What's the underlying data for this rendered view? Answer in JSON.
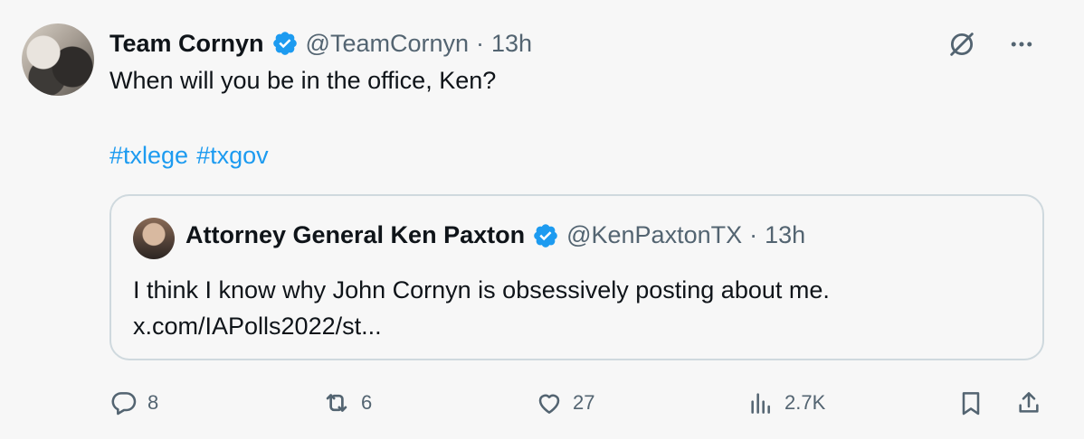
{
  "tweet": {
    "author_name": "Team Cornyn",
    "handle": "@TeamCornyn",
    "separator": "·",
    "time": "13h",
    "text": "When will you be in the office, Ken?",
    "hashtags": [
      "#txlege",
      "#txgov"
    ]
  },
  "quote": {
    "author_name": "Attorney General Ken Paxton",
    "handle": "@KenPaxtonTX",
    "separator": "·",
    "time": "13h",
    "text_line1": "I think I know why John Cornyn is obsessively posting about me.",
    "text_line2": "x.com/IAPolls2022/st..."
  },
  "actions": {
    "replies": "8",
    "reposts": "6",
    "likes": "27",
    "views": "2.7K"
  },
  "colors": {
    "link": "#1d9bf0",
    "verified": "#1d9bf0",
    "secondary_text": "#536471",
    "border": "#cfd9de"
  },
  "icons": {
    "verified": "verified-badge-icon",
    "grok": "grok-icon",
    "more": "more-icon",
    "reply": "reply-icon",
    "repost": "repost-icon",
    "like": "like-icon",
    "views": "views-icon",
    "bookmark": "bookmark-icon",
    "share": "share-icon"
  }
}
